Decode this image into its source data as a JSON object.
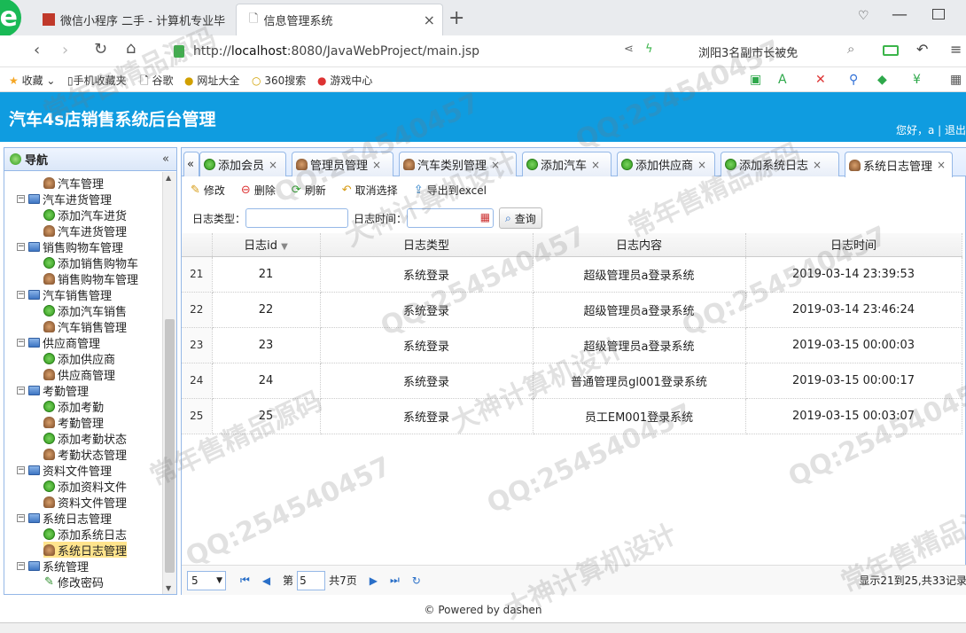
{
  "browser": {
    "tabs": [
      {
        "title": "微信小程序 二手 - 计算机专业毕"
      },
      {
        "title": "信息管理系统"
      }
    ],
    "url_prefix": "http://",
    "url_host": "localhost",
    "url_rest": ":8080/JavaWebProject/main.jsp",
    "search_text": "浏阳3名副市长被免",
    "bookmarks": [
      "收藏",
      "手机收藏夹",
      "谷歌",
      "网址大全",
      "360搜索",
      "游戏中心"
    ]
  },
  "app": {
    "title": "汽车4s店销售系统后台管理",
    "greeting": "您好，a | 退出"
  },
  "sidebar": {
    "title": "导航",
    "items": [
      {
        "label": "汽车管理",
        "level": 2,
        "icon": "user-icon"
      },
      {
        "label": "汽车进货管理",
        "level": 1,
        "icon": "folder-icon"
      },
      {
        "label": "添加汽车进货",
        "level": 2,
        "icon": "add-icon"
      },
      {
        "label": "汽车进货管理",
        "level": 2,
        "icon": "user-icon"
      },
      {
        "label": "销售购物车管理",
        "level": 1,
        "icon": "folder-icon"
      },
      {
        "label": "添加销售购物车",
        "level": 2,
        "icon": "add-icon"
      },
      {
        "label": "销售购物车管理",
        "level": 2,
        "icon": "user-icon"
      },
      {
        "label": "汽车销售管理",
        "level": 1,
        "icon": "folder-icon"
      },
      {
        "label": "添加汽车销售",
        "level": 2,
        "icon": "add-icon"
      },
      {
        "label": "汽车销售管理",
        "level": 2,
        "icon": "user-icon"
      },
      {
        "label": "供应商管理",
        "level": 1,
        "icon": "folder-icon"
      },
      {
        "label": "添加供应商",
        "level": 2,
        "icon": "add-icon"
      },
      {
        "label": "供应商管理",
        "level": 2,
        "icon": "user-icon"
      },
      {
        "label": "考勤管理",
        "level": 1,
        "icon": "folder-icon"
      },
      {
        "label": "添加考勤",
        "level": 2,
        "icon": "add-icon"
      },
      {
        "label": "考勤管理",
        "level": 2,
        "icon": "user-icon"
      },
      {
        "label": "添加考勤状态",
        "level": 2,
        "icon": "add-icon"
      },
      {
        "label": "考勤状态管理",
        "level": 2,
        "icon": "user-icon"
      },
      {
        "label": "资料文件管理",
        "level": 1,
        "icon": "folder-icon"
      },
      {
        "label": "添加资料文件",
        "level": 2,
        "icon": "add-icon"
      },
      {
        "label": "资料文件管理",
        "level": 2,
        "icon": "user-icon"
      },
      {
        "label": "系统日志管理",
        "level": 1,
        "icon": "folder-icon"
      },
      {
        "label": "添加系统日志",
        "level": 2,
        "icon": "add-icon"
      },
      {
        "label": "系统日志管理",
        "level": 2,
        "icon": "user-icon",
        "selected": true
      },
      {
        "label": "系统管理",
        "level": 1,
        "icon": "folder-icon"
      },
      {
        "label": "修改密码",
        "level": 2,
        "icon": "pen-icon"
      }
    ]
  },
  "tabs": [
    {
      "label": "添加会员",
      "icon": "add-icon"
    },
    {
      "label": "管理员管理",
      "icon": "user-icon"
    },
    {
      "label": "汽车类别管理",
      "icon": "user-icon"
    },
    {
      "label": "添加汽车",
      "icon": "add-icon"
    },
    {
      "label": "添加供应商",
      "icon": "add-icon"
    },
    {
      "label": "添加系统日志",
      "icon": "add-icon"
    },
    {
      "label": "系统日志管理",
      "icon": "user-icon",
      "active": true
    }
  ],
  "toolbar": {
    "edit": "修改",
    "delete": "删除",
    "refresh": "刷新",
    "cancel_select": "取消选择",
    "export": "导出到excel"
  },
  "search": {
    "type_label": "日志类型：",
    "time_label": "日志时间：",
    "query": "查询"
  },
  "grid": {
    "columns": [
      "日志id",
      "日志类型",
      "日志内容",
      "日志时间"
    ],
    "rows": [
      {
        "rn": "21",
        "id": "21",
        "type": "系统登录",
        "content": "超级管理员a登录系统",
        "time": "2019-03-14 23:39:53"
      },
      {
        "rn": "22",
        "id": "22",
        "type": "系统登录",
        "content": "超级管理员a登录系统",
        "time": "2019-03-14 23:46:24"
      },
      {
        "rn": "23",
        "id": "23",
        "type": "系统登录",
        "content": "超级管理员a登录系统",
        "time": "2019-03-15 00:00:03"
      },
      {
        "rn": "24",
        "id": "24",
        "type": "系统登录",
        "content": "普通管理员gl001登录系统",
        "time": "2019-03-15 00:00:17"
      },
      {
        "rn": "25",
        "id": "25",
        "type": "系统登录",
        "content": "员工EM001登录系统",
        "time": "2019-03-15 00:03:07"
      }
    ]
  },
  "pager": {
    "page_size": "5",
    "page_prefix": "第",
    "page_value": "5",
    "page_suffix": "共7页",
    "summary": "显示21到25,共33记录"
  },
  "footer": "© Powered by dashen",
  "watermarks": [
    "QQ:254540457",
    "常年售精品源码",
    "大神计算机设计"
  ]
}
